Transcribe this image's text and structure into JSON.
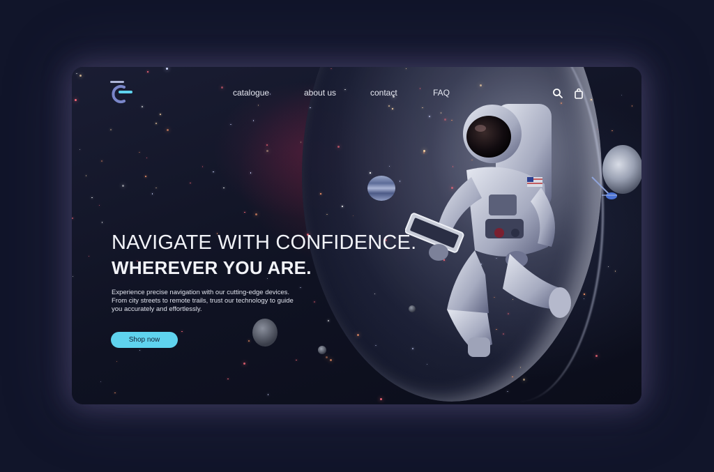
{
  "brand": {
    "logo_icon": "brand-c-logo-icon",
    "accent": "#5fd3ee",
    "accent_secondary": "#7a86c9"
  },
  "nav": {
    "items": [
      {
        "label": "catalogue"
      },
      {
        "label": "about us"
      },
      {
        "label": "contact"
      },
      {
        "label": "FAQ"
      }
    ],
    "search_icon": "search-icon",
    "cart_icon": "shopping-bag-icon"
  },
  "hero": {
    "headline_line1": "NAVIGATE WITH CONFIDENCE.",
    "headline_line2": "WHEREVER YOU ARE.",
    "description_lines": [
      "Experience precise navigation with our cutting-edge devices.",
      "From city streets to remote trails, trust our technology to guide",
      "you accurately and effortlessly."
    ],
    "cta_label": "Shop now"
  },
  "colors": {
    "page_background": "#11152a",
    "button": "#5fd3ee",
    "text": "#f2f3f8"
  }
}
